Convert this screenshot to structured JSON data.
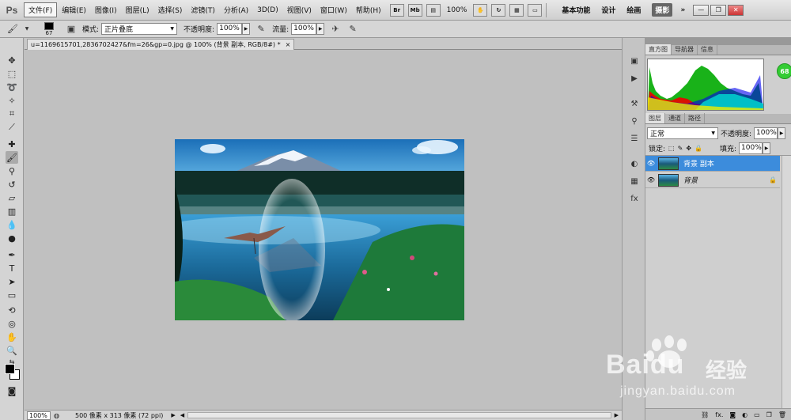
{
  "app": {
    "logo": "Ps"
  },
  "menu": {
    "items": [
      "文件(F)",
      "编辑(E)",
      "图像(I)",
      "图层(L)",
      "选择(S)",
      "滤镜(T)",
      "分析(A)",
      "3D(D)",
      "视图(V)",
      "窗口(W)",
      "帮助(H)"
    ],
    "br_label": "Br",
    "mb_label": "Mb",
    "zoom": "100%",
    "workspaces": [
      "基本功能",
      "设计",
      "绘画",
      "摄影"
    ],
    "more": "»"
  },
  "options": {
    "brush_size": "67",
    "mode_label": "模式:",
    "mode_value": "正片叠底",
    "opacity_label": "不透明度:",
    "opacity_value": "100%",
    "flow_label": "流量:",
    "flow_value": "100%"
  },
  "document": {
    "tab_title": "u=1169615701,2836702427&fm=26&gp=0.jpg @ 100% (背景 副本, RGB/8#) *",
    "close": "×"
  },
  "status": {
    "zoom": "100%",
    "info": "500 像素 x 313 像素 (72 ppi)"
  },
  "panels": {
    "top_tabs": [
      "直方图",
      "导航器",
      "信息"
    ],
    "histogram_badge": "68",
    "layer_tabs": [
      "图层",
      "通道",
      "路径"
    ],
    "blend_mode": "正常",
    "opacity_label": "不透明度:",
    "opacity_value": "100%",
    "lock_label": "锁定:",
    "fill_label": "填充:",
    "fill_value": "100%",
    "layers": [
      {
        "name": "背景 副本",
        "selected": true
      },
      {
        "name": "背景",
        "selected": false
      }
    ],
    "footer_icons": [
      "link-icon",
      "fx-icon",
      "mask-icon",
      "adjustment-icon",
      "folder-icon",
      "new-layer-icon",
      "trash-icon"
    ]
  },
  "watermark": {
    "brand": "Baidu",
    "brand_cn": "经验",
    "url": "jingyan.baidu.com"
  }
}
